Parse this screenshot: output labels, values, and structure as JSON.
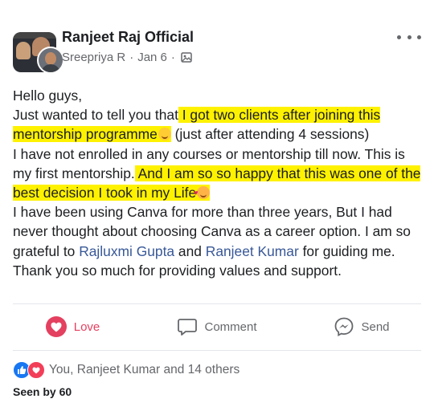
{
  "post": {
    "group_name": "Ranjeet Raj Official",
    "author": "Sreepriya R",
    "date": "Jan 6",
    "separator": "·",
    "privacy_icon": "gallery-icon",
    "more_icon": "more-horizontal-icon"
  },
  "body": {
    "line1": "Hello guys,",
    "seg1": "Just wanted to tell you that",
    "seg2": " I got two clients after joining this mentorship programme",
    "seg3": " (just after attending 4 sessions)",
    "seg4": "I have not enrolled in any courses or mentorship till now. This is my first mentorship.",
    "seg5": " And I am so so happy that this was one of the best decision I took in my Life",
    "seg6": "I have been using Canva for more than three years, But I had never thought about choosing Canva as a career option. I am so grateful to ",
    "mention1": "Rajluxmi Gupta",
    "seg7": " and ",
    "mention2": "Ranjeet Kumar",
    "seg8": " for guiding me.",
    "seg9": "Thank you so much for providing values and support.",
    "highlight_color": "#fff200",
    "emoji1": "smiling-face-emoji",
    "emoji2": "smiling-face-with-hearts-emoji"
  },
  "actions": {
    "love_label": "Love",
    "comment_label": "Comment",
    "send_label": "Send"
  },
  "reactions": {
    "summary": "You, Ranjeet Kumar and 14 others",
    "icons": [
      "like-icon",
      "love-icon"
    ]
  },
  "seen": {
    "label": "Seen by 60"
  },
  "colors": {
    "love": "#e4405f",
    "like": "#1877f2",
    "mention": "#385898",
    "muted": "#65676b"
  }
}
